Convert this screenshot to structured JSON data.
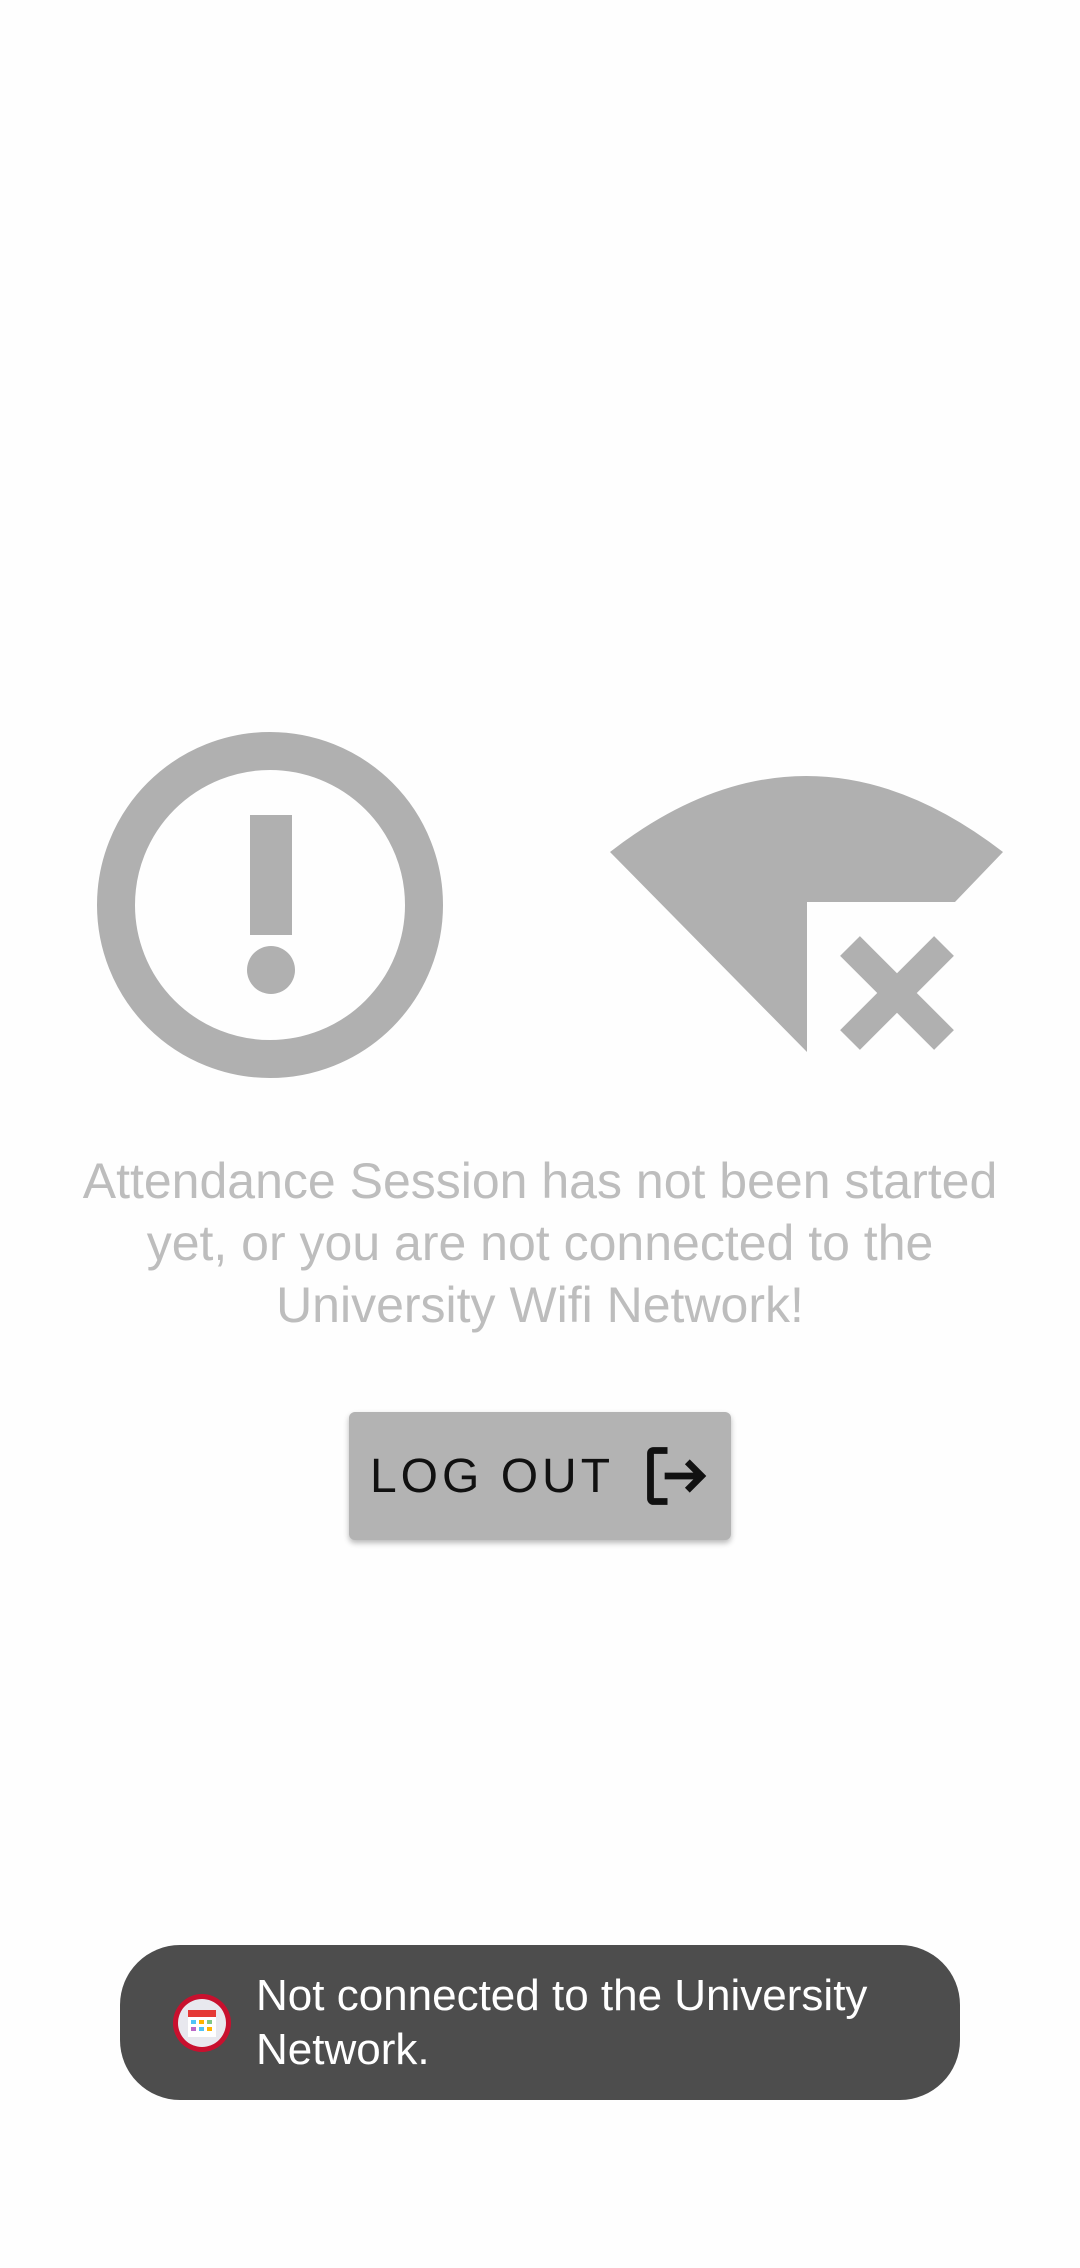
{
  "status": {
    "message": "Attendance Session has not been started yet, or you are not connected to the University Wifi Network!"
  },
  "icons": {
    "alert": "alert-circle-icon",
    "wifi": "wifi-off-icon",
    "logout": "logout-icon",
    "app": "calendar-app-icon"
  },
  "logout_button": {
    "label": "LOG OUT"
  },
  "toast": {
    "text": "Not connected to the University Network."
  },
  "colors": {
    "icon_gray": "#b0b0b0",
    "message_text": "#bdbdbd",
    "button_bg": "#b3b3b3",
    "toast_bg": "#4d4d4d",
    "app_icon_red": "#c8102e"
  }
}
